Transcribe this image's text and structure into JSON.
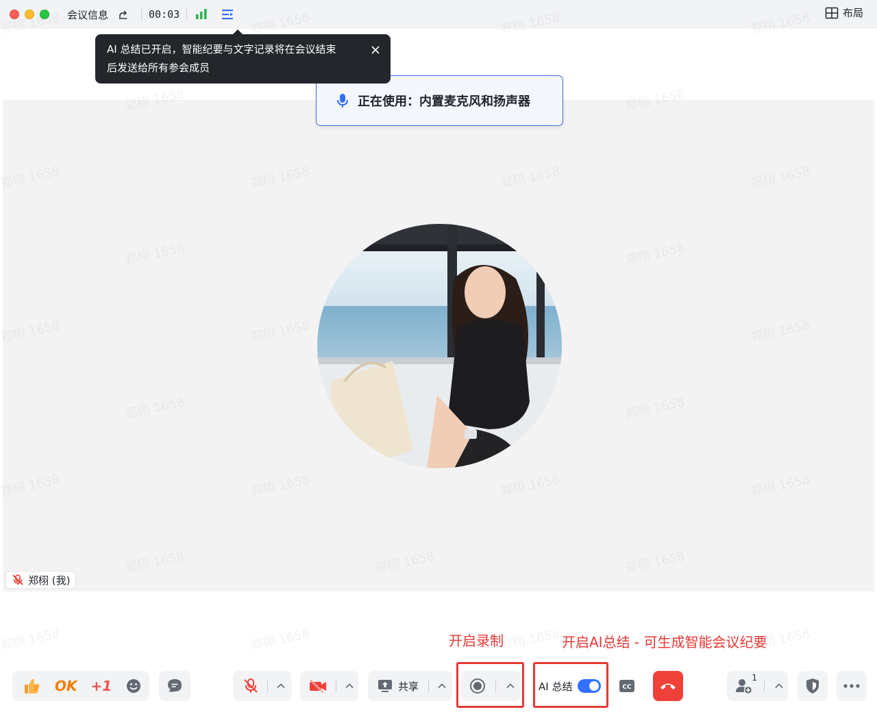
{
  "titlebar": {
    "meeting_info": "会议信息",
    "timer": "00:03",
    "layout_label": "布局"
  },
  "toast": {
    "line1": "AI 总结已开启，智能纪要与文字记录将在会议结束",
    "line2": "后发送给所有参会成员"
  },
  "device_notice": {
    "text": "正在使用：内置麦克风和扬声器"
  },
  "participant": {
    "name": "郑栩 (我)"
  },
  "annotations": {
    "record": "开启录制",
    "ai": "开启AI总结 - 可生成智能会议纪要"
  },
  "toolbar": {
    "reactions": {
      "ok": "OK",
      "plus_one": "+1"
    },
    "share_label": "共享",
    "ai_label": "AI 总结",
    "cc_label": "CC",
    "invite_count": "1"
  },
  "watermark": "郑栩 1658",
  "colors": {
    "accent": "#3370ff",
    "end_call": "#f0403a",
    "annotation": "#e53935",
    "toast_bg": "#23262b"
  }
}
